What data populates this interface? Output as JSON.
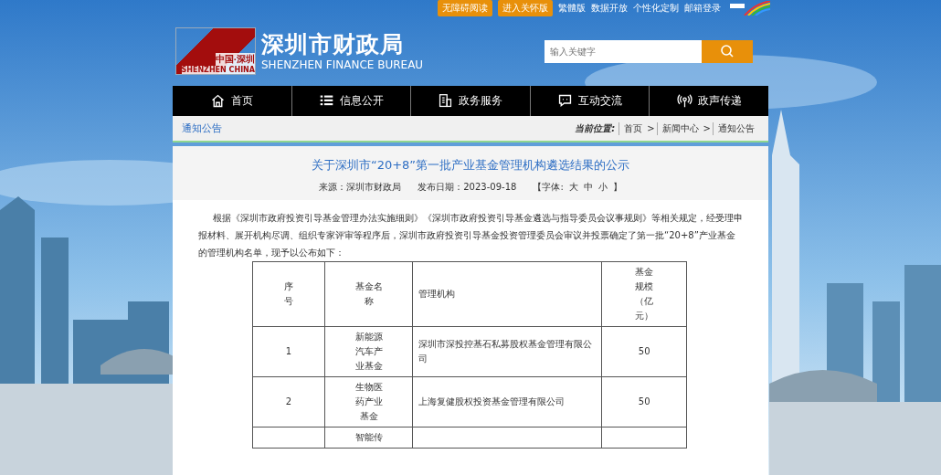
{
  "top_bar": {
    "buttons": [
      "无障碍阅读",
      "进入关怀版"
    ],
    "links": [
      "繁體版",
      "数据开放",
      "个性化定制",
      "邮箱登录"
    ]
  },
  "header": {
    "logo_text": "中国·深圳",
    "logo_subtext": "SHENZHEN CHINA",
    "title": "深圳市财政局",
    "subtitle": "SHENZHEN FINANCE BUREAU",
    "search": {
      "placeholder": "输入关键字"
    }
  },
  "nav": [
    {
      "label": "首页"
    },
    {
      "label": "信息公开"
    },
    {
      "label": "政务服务"
    },
    {
      "label": "互动交流"
    },
    {
      "label": "政声传递"
    }
  ],
  "section": {
    "title": "通知公告",
    "location_label": "当前位置:",
    "breadcrumb": [
      "首页",
      "新闻中心",
      "通知公告"
    ],
    "separator": ">"
  },
  "article": {
    "title": "关于深圳市“20+8”第一批产业基金管理机构遴选结果的公示",
    "source": "来源：深圳市财政局",
    "date": "发布日期：2023-09-18",
    "font_label": "【字体:",
    "font_sizes": [
      "大",
      "中",
      "小"
    ],
    "font_close": "】",
    "body": "根据《深圳市政府投资引导基金管理办法实施细则》《深圳市政府投资引导基金遴选与指导委员会议事规则》等相关规定，经受理申报材料、展开机构尽调、组织专家评审等程序后，深圳市政府投资引导基金投资管理委员会审议并投票确定了第一批“20+8”产业基金的管理机构名单，现予以公布如下：",
    "table": {
      "columns": [
        "序号",
        "基金名称",
        "管理机构",
        "基金规模（亿元）"
      ],
      "rows": [
        {
          "seq": "1",
          "fund": "新能源汽车产业基金",
          "manager": "深圳市深投控基石私募股权基金管理有限公司",
          "size": "50"
        },
        {
          "seq": "2",
          "fund": "生物医药产业基金",
          "manager": "上海复健股权投资基金管理有限公司",
          "size": "50"
        },
        {
          "fund": "智能传"
        }
      ]
    }
  }
}
